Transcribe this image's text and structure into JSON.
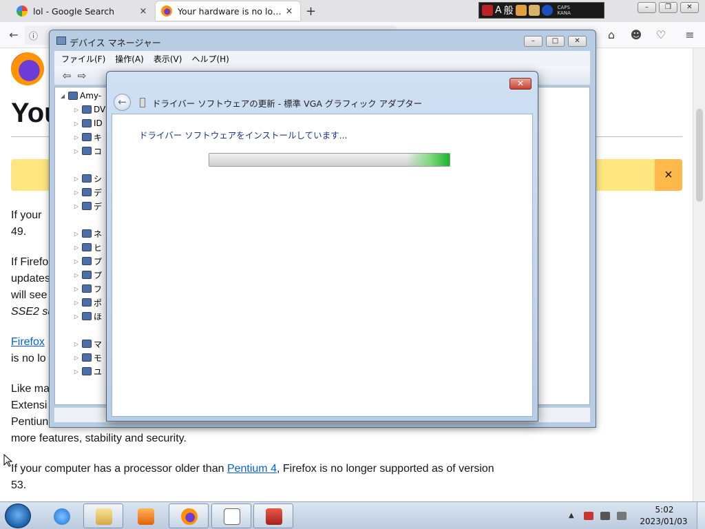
{
  "browser": {
    "tabs": [
      {
        "title": "lol - Google Search",
        "favicon": "google-icon"
      },
      {
        "title": "Your hardware is no lon...",
        "favicon": "firefox-icon"
      }
    ],
    "new_tab_label": "+",
    "tab_close_glyph": "×",
    "ime": {
      "char1": "A",
      "char2": "般",
      "caps": "CAPS",
      "kana": "KANA"
    },
    "window_controls": {
      "minimize": "–",
      "maximize": "❐",
      "close": "✕"
    }
  },
  "webpage": {
    "headline": "You",
    "notice_close": "×",
    "paragraphs": [
      {
        "lines": [
          "If your",
          "49."
        ]
      },
      {
        "lines": [
          "If Firefo",
          "updates",
          "will see",
          "SSE2 su"
        ]
      },
      {
        "lines": [
          "Firefox",
          "is no lo"
        ]
      },
      {
        "lines": [
          "Like ma",
          "Extensi",
          "Pentiun",
          "more features, stability and security."
        ]
      },
      {
        "lines": [
          "If your computer has a processor older than ",
          "Pentium 4",
          ", Firefox is no longer supported as of version",
          "53."
        ]
      }
    ]
  },
  "device_manager": {
    "title": "デバイス マネージャー",
    "menu": [
      "ファイル(F)",
      "操作(A)",
      "表示(V)",
      "ヘルプ(H)"
    ],
    "tree_root": "Amy-",
    "tree_items": [
      "DV",
      "ID",
      "キ",
      "コ",
      "シ",
      "デ",
      "デ",
      "ネ",
      "ヒ",
      "プ",
      "プ",
      "フ",
      "ポ",
      "ほ",
      "マ",
      "モ",
      "ユ"
    ],
    "window_controls": {
      "minimize": "–",
      "maximize": "□",
      "close": "✕"
    }
  },
  "driver_dialog": {
    "title": "ドライバー ソフトウェアの更新 - 標準 VGA グラフィック アダプター",
    "status": "ドライバー ソフトウェアをインストールしています...",
    "progress": 1.0,
    "close_glyph": "✕",
    "back_glyph": "←"
  },
  "taskbar": {
    "pinned": [
      "internet-explorer-icon",
      "windows-explorer-icon",
      "media-player-icon",
      "firefox-icon",
      "notepad-icon",
      "toolbox-icon"
    ],
    "clock_time": "5:02",
    "clock_date": "2023/01/03",
    "tray_arrow": "▲"
  },
  "colors": {
    "accent": "#0060df",
    "notice_bg": "#ffe680",
    "progress_green": "#18b52c"
  }
}
